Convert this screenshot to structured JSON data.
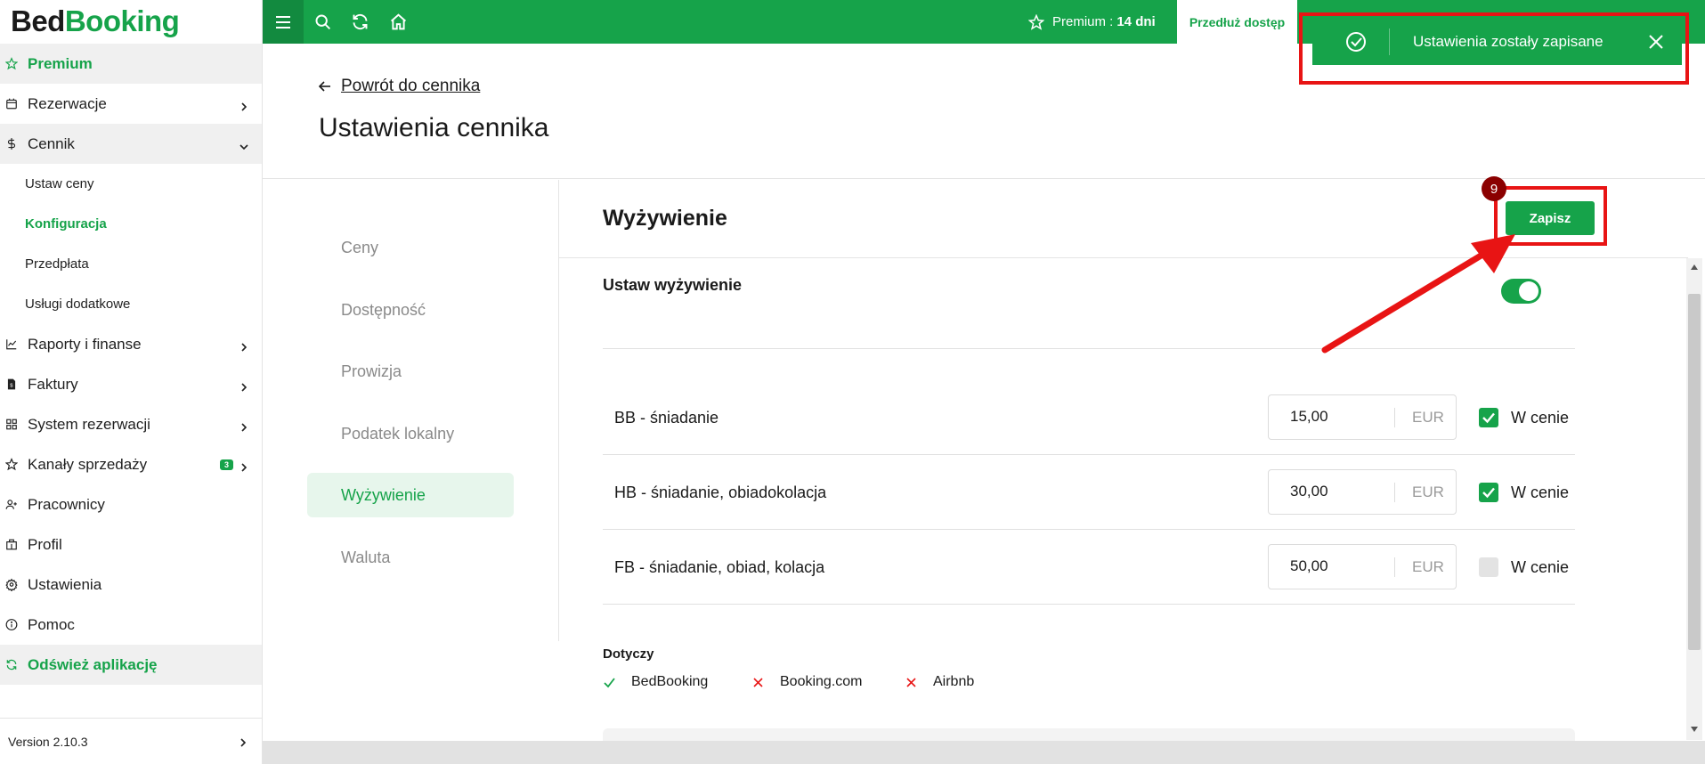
{
  "logo": {
    "part1": "Bed",
    "part2": "Booking"
  },
  "sidebar": {
    "premium": "Premium",
    "items": [
      {
        "label": "Rezerwacje",
        "icon": "calendar-icon"
      },
      {
        "label": "Cennik",
        "icon": "dollar-icon"
      },
      {
        "label": "Raporty i finanse",
        "icon": "chart-icon"
      },
      {
        "label": "Faktury",
        "icon": "invoice-icon"
      },
      {
        "label": "System rezerwacji",
        "icon": "grid-icon"
      },
      {
        "label": "Kanały sprzedaży",
        "icon": "star-icon",
        "badge": "3"
      },
      {
        "label": "Pracownicy",
        "icon": "user-plus-icon"
      },
      {
        "label": "Profil",
        "icon": "building-icon"
      },
      {
        "label": "Ustawienia",
        "icon": "gear-icon"
      },
      {
        "label": "Pomoc",
        "icon": "info-icon"
      }
    ],
    "subitems": [
      "Ustaw ceny",
      "Konfiguracja",
      "Przedpłata",
      "Usługi dodatkowe"
    ],
    "refresh": "Odśwież aplikację",
    "version": "Version 2.10.3"
  },
  "topbar": {
    "premium_label": "Premium :",
    "premium_days": "14 dni",
    "extend_button": "Przedłuż dostęp"
  },
  "toast": {
    "message": "Ustawienia zostały zapisane"
  },
  "header": {
    "back_link": "Powrót do cennika",
    "title": "Ustawienia cennika"
  },
  "tabs": [
    "Ceny",
    "Dostępność",
    "Prowizja",
    "Podatek lokalny",
    "Wyżywienie",
    "Waluta"
  ],
  "section": {
    "title": "Wyżywienie",
    "save_button": "Zapisz",
    "step_number": "9",
    "toggle_label": "Ustaw wyżywienie",
    "toggle_on": true
  },
  "meals": [
    {
      "label": "BB - śniadanie",
      "price": "15,00",
      "currency": "EUR",
      "included": true,
      "included_label": "W cenie"
    },
    {
      "label": "HB - śniadanie, obiadokolacja",
      "price": "30,00",
      "currency": "EUR",
      "included": true,
      "included_label": "W cenie"
    },
    {
      "label": "FB - śniadanie, obiad, kolacja",
      "price": "50,00",
      "currency": "EUR",
      "included": false,
      "included_label": "W cenie"
    }
  ],
  "applies": {
    "title": "Dotyczy",
    "channels": [
      {
        "name": "BedBooking",
        "status": "check",
        "color": "#16a34a"
      },
      {
        "name": "Booking.com",
        "status": "cross",
        "color": "#e81414"
      },
      {
        "name": "Airbnb",
        "status": "cross",
        "color": "#e81414"
      }
    ]
  },
  "colors": {
    "brand": "#16a34a",
    "highlight": "#e81414",
    "step_badge": "#8b0000"
  }
}
